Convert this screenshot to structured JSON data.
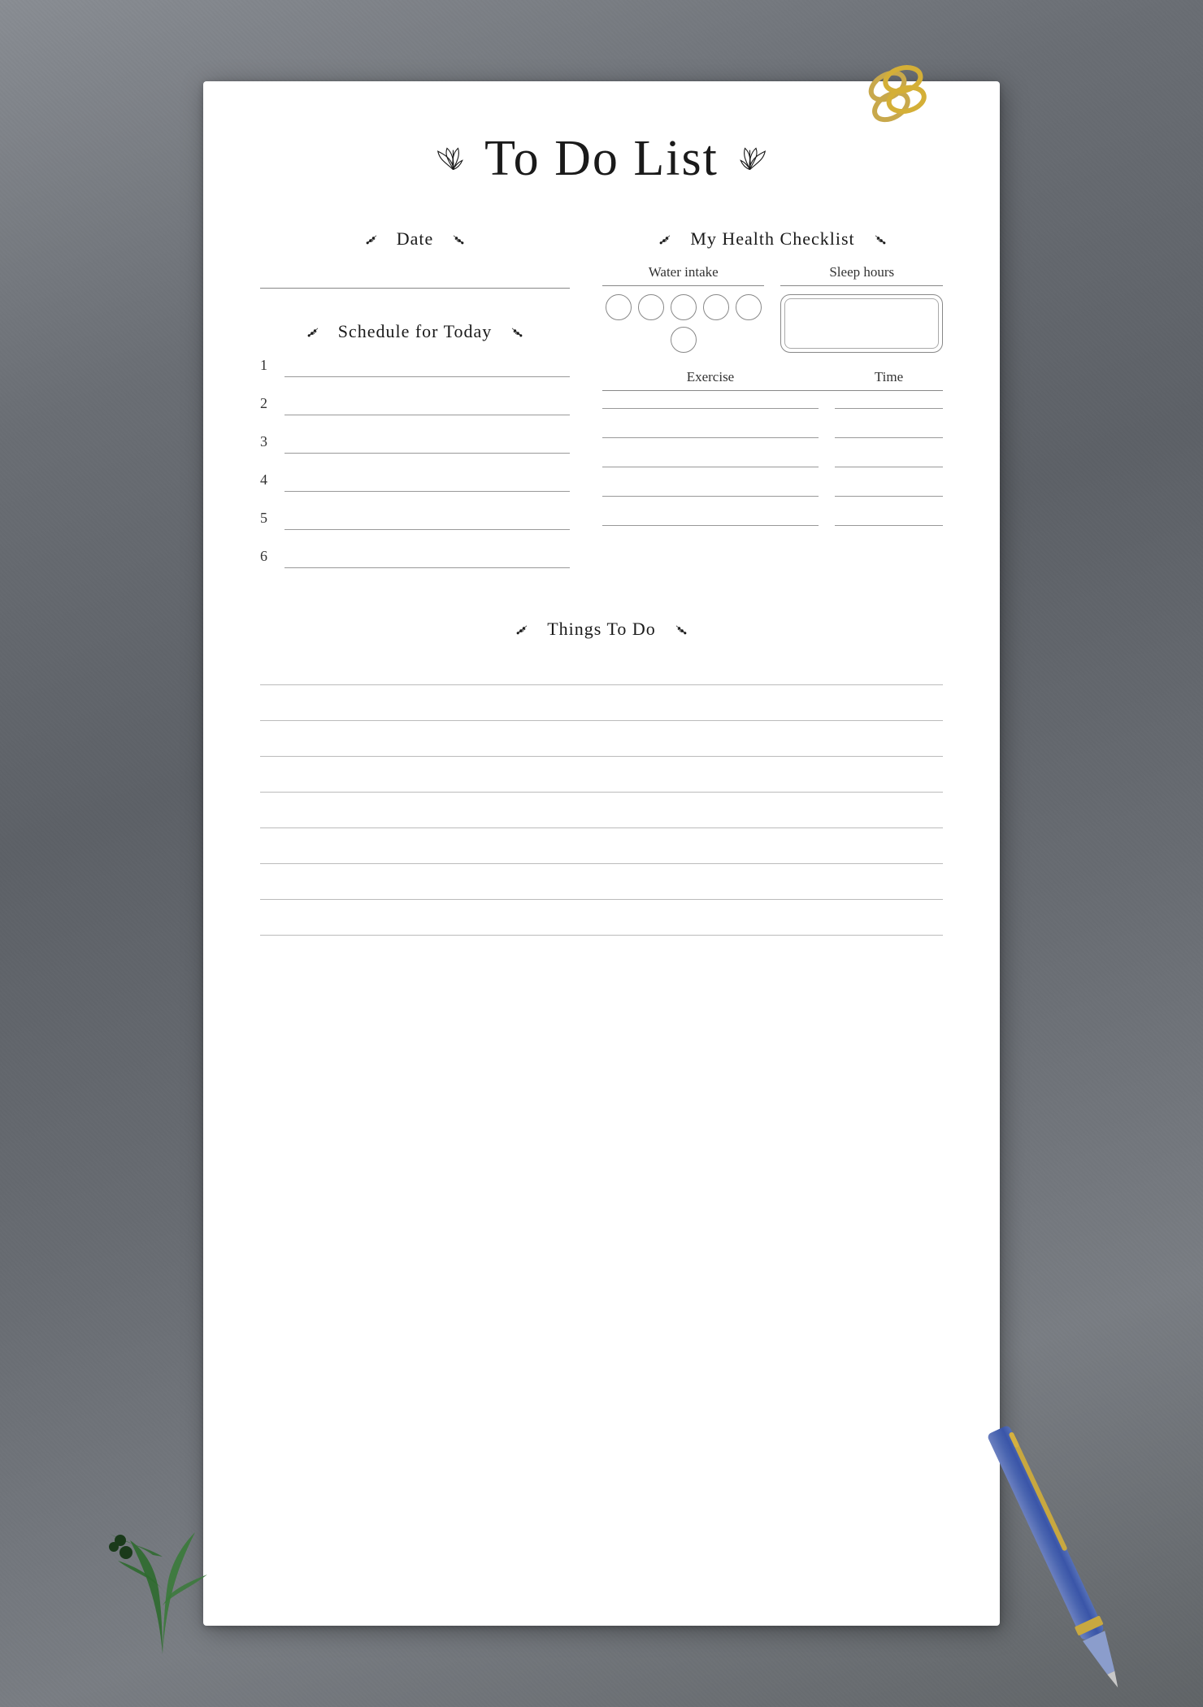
{
  "page": {
    "background_color": "#6b7278",
    "paper_bg": "#ffffff"
  },
  "title": {
    "text": "To Do List",
    "leaf_left": "🌿",
    "leaf_right": "🌿"
  },
  "date_section": {
    "label": "Date",
    "branch_left": "❧",
    "branch_right": "❧"
  },
  "schedule_section": {
    "label": "Schedule for Today",
    "branch_left": "❧",
    "branch_right": "❧",
    "items": [
      {
        "number": "1"
      },
      {
        "number": "2"
      },
      {
        "number": "3"
      },
      {
        "number": "4"
      },
      {
        "number": "5"
      },
      {
        "number": "6"
      }
    ]
  },
  "health_section": {
    "label": "My Health Checklist",
    "branch_left": "❧",
    "branch_right": "❧",
    "water_label": "Water intake",
    "sleep_label": "Sleep hours",
    "exercise_label": "Exercise",
    "time_label": "Time",
    "water_circles": 6,
    "exercise_rows": 5
  },
  "things_section": {
    "label": "Things To Do",
    "branch_left": "❧",
    "branch_right": "❧",
    "lines": 8
  }
}
